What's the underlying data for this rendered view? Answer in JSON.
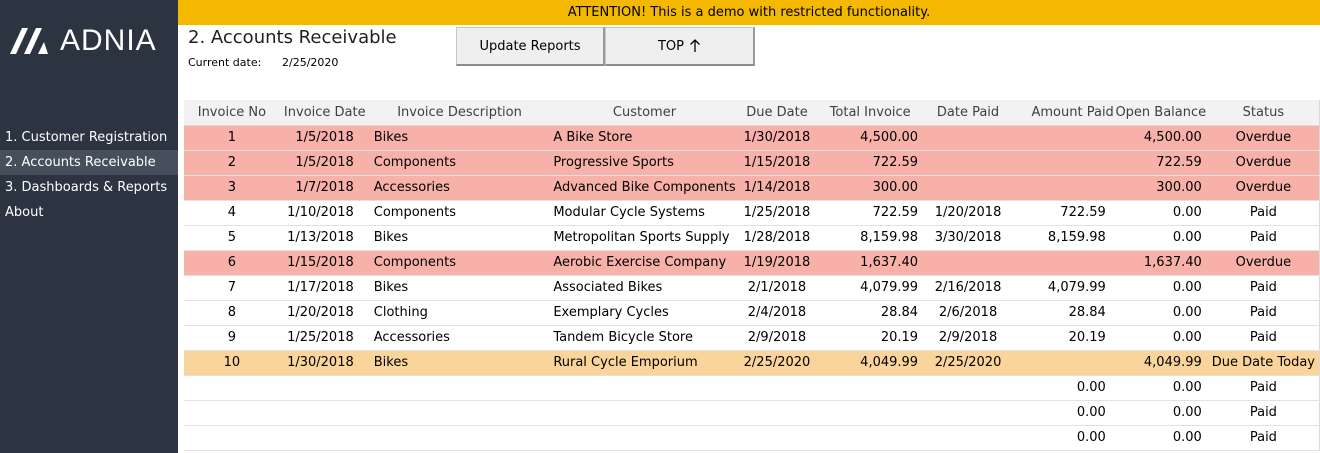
{
  "banner": {
    "text": "ATTENTION! This is a demo with restricted functionality."
  },
  "brand": {
    "name": "ADNIA",
    "mark_icon": "adnia-logo-mark"
  },
  "sidebar": {
    "items": [
      {
        "label": "1. Customer Registration",
        "active": false
      },
      {
        "label": "2. Accounts Receivable",
        "active": true
      },
      {
        "label": "3. Dashboards & Reports",
        "active": false
      },
      {
        "label": "About",
        "active": false
      }
    ]
  },
  "header": {
    "title": "2. Accounts Receivable",
    "current_date_label": "Current date:",
    "current_date_value": "2/25/2020"
  },
  "toolbar": {
    "update_label": "Update Reports",
    "top_label": "TOP",
    "top_icon": "arrow-up-icon"
  },
  "colors": {
    "sidebar": "#2b3440",
    "banner": "#f5b800",
    "overdue": "#f7b1a8",
    "due_today": "#f9d49b"
  },
  "table": {
    "headers": [
      "Invoice No",
      "Invoice Date",
      "Invoice Description",
      "Customer",
      "Due Date",
      "Total Invoice",
      "Date Paid",
      "Amount Paid",
      "Open Balance",
      "Status"
    ],
    "rows": [
      {
        "no": "1",
        "date": "1/5/2018",
        "desc": "Bikes",
        "customer": "A Bike Store",
        "due": "1/30/2018",
        "total": "4,500.00",
        "paid_date": "",
        "amount_paid": "",
        "balance": "4,500.00",
        "status": "Overdue"
      },
      {
        "no": "2",
        "date": "1/5/2018",
        "desc": "Components",
        "customer": "Progressive Sports",
        "due": "1/15/2018",
        "total": "722.59",
        "paid_date": "",
        "amount_paid": "",
        "balance": "722.59",
        "status": "Overdue"
      },
      {
        "no": "3",
        "date": "1/7/2018",
        "desc": "Accessories",
        "customer": "Advanced Bike Components",
        "due": "1/14/2018",
        "total": "300.00",
        "paid_date": "",
        "amount_paid": "",
        "balance": "300.00",
        "status": "Overdue"
      },
      {
        "no": "4",
        "date": "1/10/2018",
        "desc": "Components",
        "customer": "Modular Cycle Systems",
        "due": "1/25/2018",
        "total": "722.59",
        "paid_date": "1/20/2018",
        "amount_paid": "722.59",
        "balance": "0.00",
        "status": "Paid"
      },
      {
        "no": "5",
        "date": "1/13/2018",
        "desc": "Bikes",
        "customer": "Metropolitan Sports Supply",
        "due": "1/28/2018",
        "total": "8,159.98",
        "paid_date": "3/30/2018",
        "amount_paid": "8,159.98",
        "balance": "0.00",
        "status": "Paid"
      },
      {
        "no": "6",
        "date": "1/15/2018",
        "desc": "Components",
        "customer": "Aerobic Exercise Company",
        "due": "1/19/2018",
        "total": "1,637.40",
        "paid_date": "",
        "amount_paid": "",
        "balance": "1,637.40",
        "status": "Overdue"
      },
      {
        "no": "7",
        "date": "1/17/2018",
        "desc": "Bikes",
        "customer": "Associated Bikes",
        "due": "2/1/2018",
        "total": "4,079.99",
        "paid_date": "2/16/2018",
        "amount_paid": "4,079.99",
        "balance": "0.00",
        "status": "Paid"
      },
      {
        "no": "8",
        "date": "1/20/2018",
        "desc": "Clothing",
        "customer": "Exemplary Cycles",
        "due": "2/4/2018",
        "total": "28.84",
        "paid_date": "2/6/2018",
        "amount_paid": "28.84",
        "balance": "0.00",
        "status": "Paid"
      },
      {
        "no": "9",
        "date": "1/25/2018",
        "desc": "Accessories",
        "customer": "Tandem Bicycle Store",
        "due": "2/9/2018",
        "total": "20.19",
        "paid_date": "2/9/2018",
        "amount_paid": "20.19",
        "balance": "0.00",
        "status": "Paid"
      },
      {
        "no": "10",
        "date": "1/30/2018",
        "desc": "Bikes",
        "customer": "Rural Cycle Emporium",
        "due": "2/25/2020",
        "total": "4,049.99",
        "paid_date": "2/25/2020",
        "amount_paid": "",
        "balance": "4,049.99",
        "status": "Due Date Today"
      },
      {
        "no": "",
        "date": "",
        "desc": "",
        "customer": "",
        "due": "",
        "total": "",
        "paid_date": "",
        "amount_paid": "0.00",
        "balance": "0.00",
        "status": "Paid"
      },
      {
        "no": "",
        "date": "",
        "desc": "",
        "customer": "",
        "due": "",
        "total": "",
        "paid_date": "",
        "amount_paid": "0.00",
        "balance": "0.00",
        "status": "Paid"
      },
      {
        "no": "",
        "date": "",
        "desc": "",
        "customer": "",
        "due": "",
        "total": "",
        "paid_date": "",
        "amount_paid": "0.00",
        "balance": "0.00",
        "status": "Paid"
      }
    ]
  }
}
